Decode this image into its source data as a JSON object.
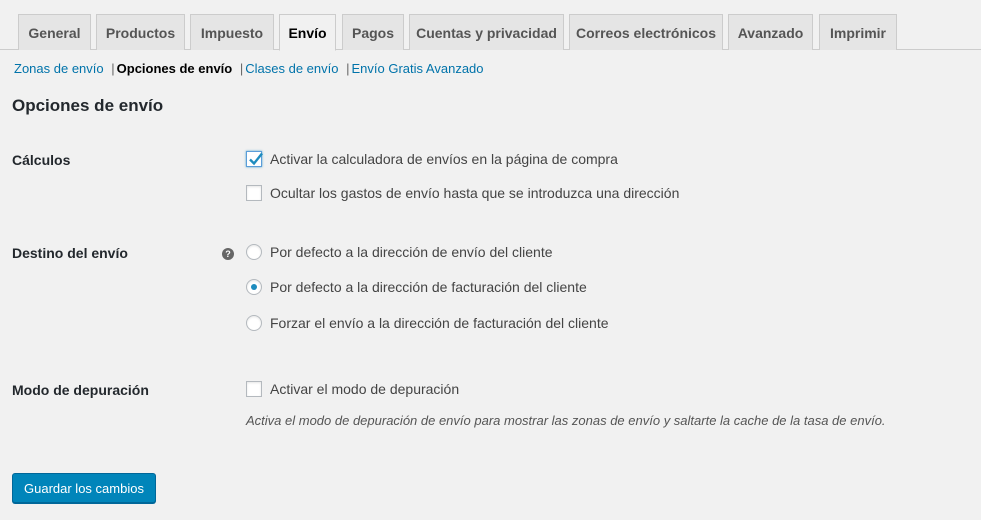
{
  "tabs": [
    {
      "label": "General"
    },
    {
      "label": "Productos"
    },
    {
      "label": "Impuesto"
    },
    {
      "label": "Envío",
      "active": true
    },
    {
      "label": "Pagos"
    },
    {
      "label": "Cuentas y privacidad"
    },
    {
      "label": "Correos electrónicos"
    },
    {
      "label": "Avanzado"
    },
    {
      "label": "Imprimir"
    }
  ],
  "subnav": {
    "zones": "Zonas de envío",
    "options": "Opciones de envío",
    "classes": "Clases de envío",
    "free": "Envío Gratis Avanzado",
    "sep": "|"
  },
  "page_title": "Opciones de envío",
  "calculos": {
    "label": "Cálculos",
    "calculator": {
      "text": "Activar la calculadora de envíos en la página de compra",
      "checked": true
    },
    "hide_costs": {
      "text": "Ocultar los gastos de envío hasta que se introduzca una dirección",
      "checked": false
    }
  },
  "destino": {
    "label": "Destino del envío",
    "help_icon": "help-icon",
    "help_glyph": "?",
    "options": [
      {
        "text": "Por defecto a la dirección de envío del cliente",
        "selected": false
      },
      {
        "text": "Por defecto a la dirección de facturación del cliente",
        "selected": true
      },
      {
        "text": "Forzar el envío a la dirección de facturación del cliente",
        "selected": false
      }
    ]
  },
  "debug": {
    "label": "Modo de depuración",
    "checkbox_text": "Activar el modo de depuración",
    "checked": false,
    "description": "Activa el modo de depuración de envío para mostrar las zonas de envío y saltarte la cache de la tasa de envío."
  },
  "save_button": "Guardar los cambios",
  "colors": {
    "link": "#0073aa",
    "primary": "#0085ba",
    "radio_dot": "#1e8cbe"
  }
}
